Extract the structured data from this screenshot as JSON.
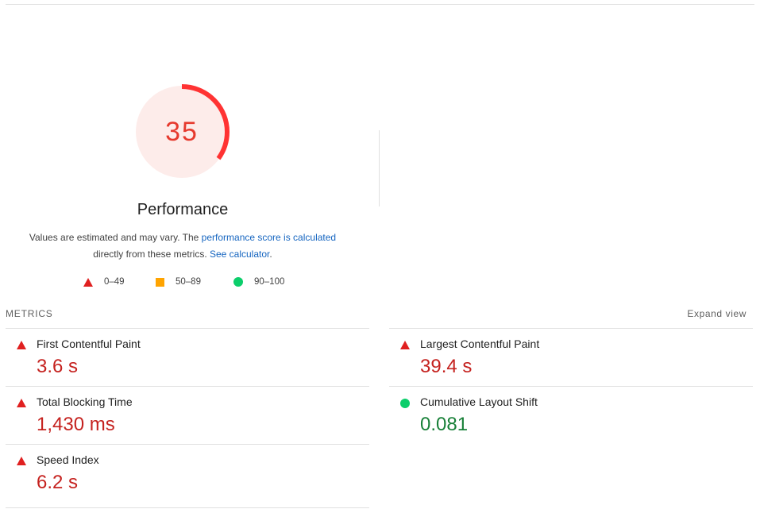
{
  "gauge": {
    "score": "35",
    "fraction": 0.35,
    "title": "Performance",
    "color": "#e63a2e",
    "fill_color": "#fdecea"
  },
  "description": {
    "prefix": "Values are estimated and may vary. The ",
    "link1": "performance score is calculated",
    "middle": " directly from these metrics. ",
    "link2": "See calculator",
    "suffix": "."
  },
  "legend": [
    {
      "icon": "red-triangle-icon",
      "label": "0–49",
      "color": "#e02020"
    },
    {
      "icon": "orange-square-icon",
      "label": "50–89",
      "color": "#ffa400"
    },
    {
      "icon": "green-circle-icon",
      "label": "90–100",
      "color": "#0cce6b"
    }
  ],
  "metrics_section": {
    "title": "METRICS",
    "expand_label": "Expand view"
  },
  "metrics": [
    {
      "label": "First Contentful Paint",
      "value": "3.6 s",
      "status": "fail",
      "icon": "red-triangle-icon"
    },
    {
      "label": "Largest Contentful Paint",
      "value": "39.4 s",
      "status": "fail",
      "icon": "red-triangle-icon"
    },
    {
      "label": "Total Blocking Time",
      "value": "1,430 ms",
      "status": "fail",
      "icon": "red-triangle-icon"
    },
    {
      "label": "Cumulative Layout Shift",
      "value": "0.081",
      "status": "pass",
      "icon": "green-circle-icon"
    },
    {
      "label": "Speed Index",
      "value": "6.2 s",
      "status": "fail",
      "icon": "red-triangle-icon"
    }
  ]
}
